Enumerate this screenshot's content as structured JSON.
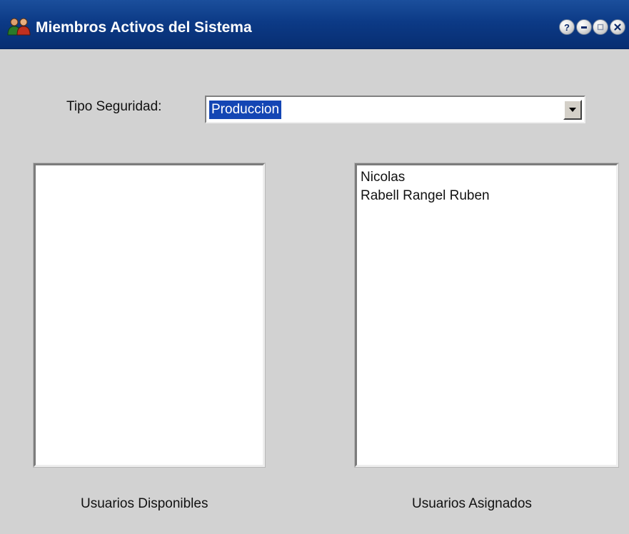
{
  "window": {
    "title": "Miembros Activos del Sistema",
    "icon": "users-icon",
    "controls": [
      "help-icon",
      "minimize-icon",
      "maximize-icon",
      "close-icon"
    ]
  },
  "form": {
    "tipo_label": "Tipo Seguridad:",
    "tipo_value": "Produccion"
  },
  "lists": {
    "disponibles": {
      "caption": "Usuarios Disponibles",
      "items": []
    },
    "asignados": {
      "caption": "Usuarios Asignados",
      "items": [
        "Nicolas",
        "Rabell Rangel Ruben"
      ]
    }
  },
  "colors": {
    "titlebar": "#0c3a86",
    "background": "#d2d2d2",
    "selection": "#1446b4"
  }
}
